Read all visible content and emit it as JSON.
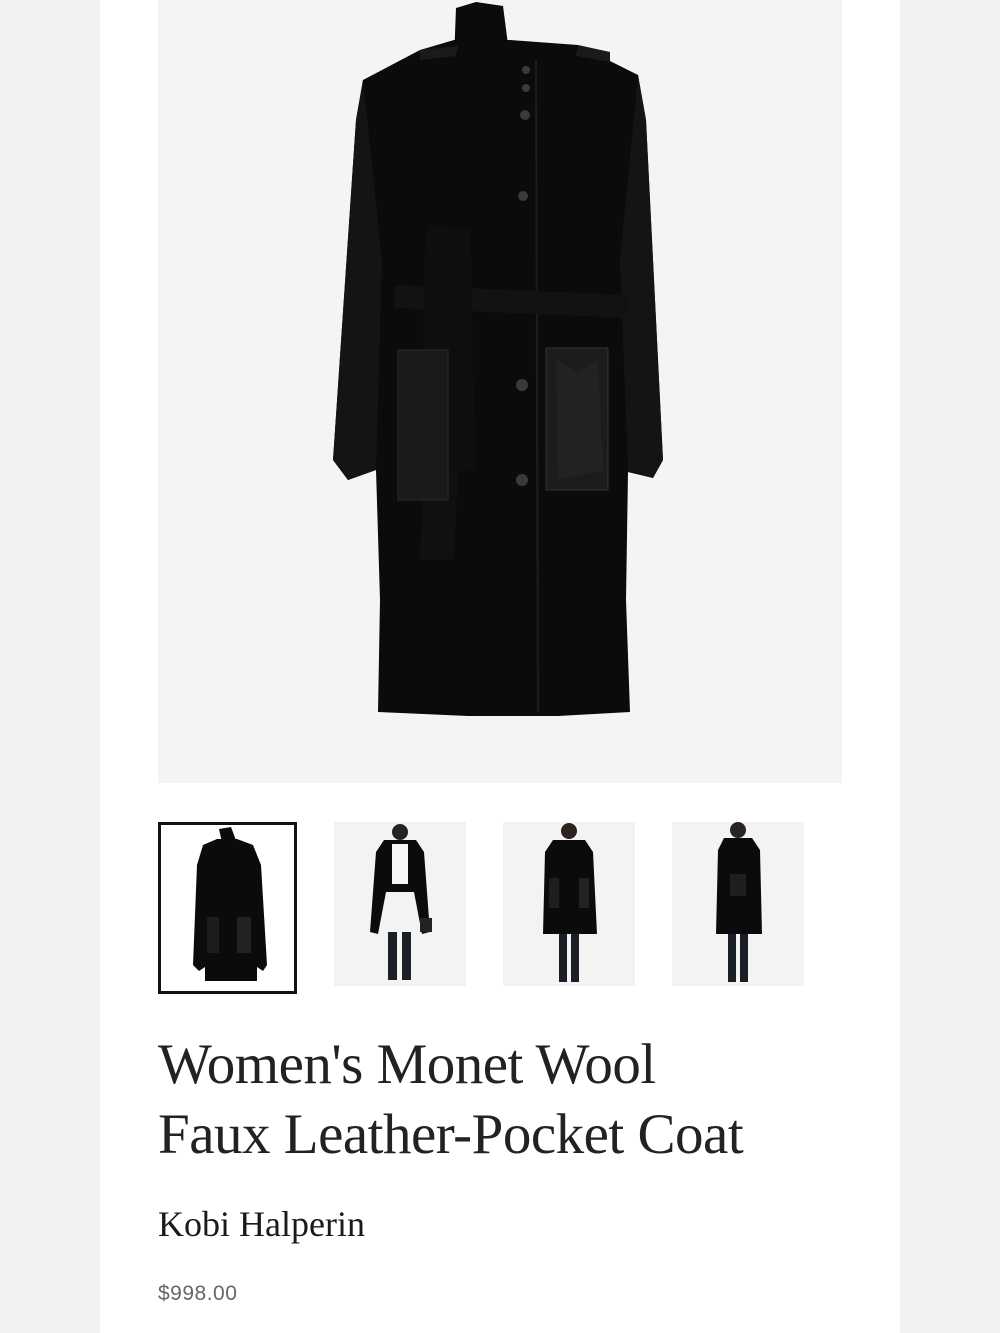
{
  "product": {
    "title_line1": "Women's Monet Wool",
    "title_line2": "Faux Leather-Pocket Coat",
    "brand": "Kobi Halperin",
    "price": "$998.00"
  },
  "gallery": {
    "main_image": "coat-front-flatlay",
    "thumbnails": [
      {
        "image": "coat-front-flatlay",
        "selected": true
      },
      {
        "image": "model-open-coat",
        "selected": false
      },
      {
        "image": "model-front-coat",
        "selected": false
      },
      {
        "image": "model-side-coat",
        "selected": false
      }
    ]
  },
  "colors": {
    "coat": "#0b0b0b",
    "leather": "#1c1c1c",
    "background": "#f4f4f4",
    "selected_border": "#111111"
  }
}
